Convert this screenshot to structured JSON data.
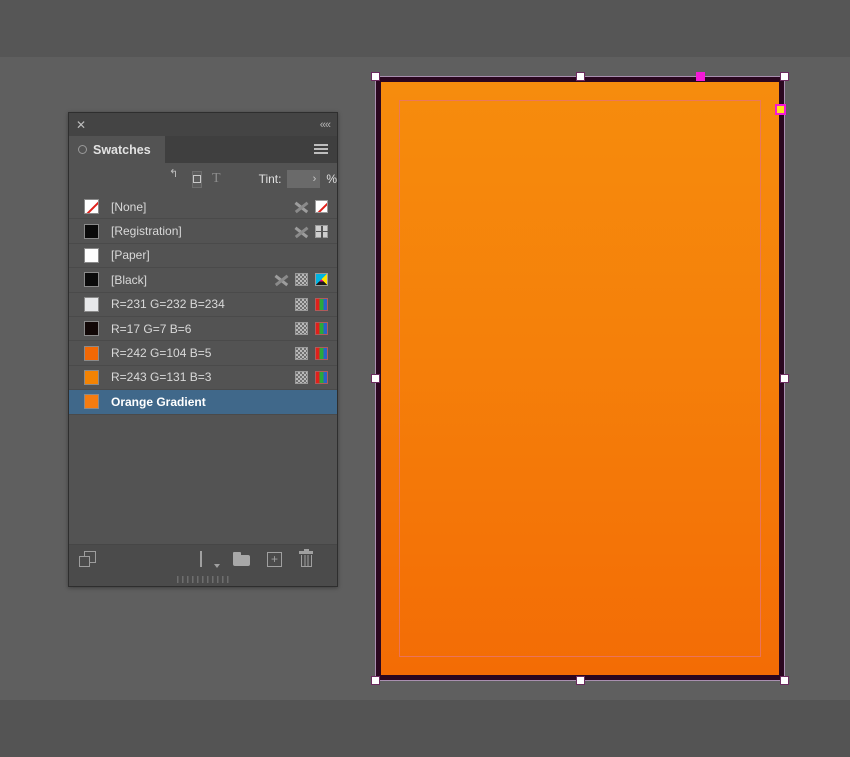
{
  "canvas": {
    "background_top": "#565656",
    "background_mid": "#5f5f5f",
    "background_bottom": "#545454"
  },
  "artwork": {
    "name": "orange-gradient-rectangle",
    "bleed_color": "#2b0720",
    "bleed_outline": "#a98fb0",
    "fill_gradient_start": "#f68c0d",
    "fill_gradient_end": "#f36c05",
    "margin_guide_color": "#e8746a",
    "handle_color": "#ffffff",
    "handle_active_color": "#f518d8",
    "anchor_fill": "#ffe11a",
    "anchor_stroke": "#f518d8"
  },
  "panel": {
    "close_icon": "✕",
    "collapse_icon": "««",
    "tab_label": "Swatches",
    "menu_icon": "hamburger-icon",
    "selected_row_color": "#40688a",
    "background": "#535353"
  },
  "options": {
    "corner_glyph": "↰",
    "fill_stroke_icon": "fill-stroke-icon",
    "text_format_icon": "T",
    "tint_label": "Tint:",
    "tint_value": "",
    "tint_placeholder": "",
    "tint_stepper_icon": "›",
    "tint_unit": "%"
  },
  "swatch_list": {
    "rows": [
      {
        "name": "[None]",
        "chip": "none",
        "chip_color": "#ffffff",
        "lock": true,
        "kind": "none-box",
        "color_space": ""
      },
      {
        "name": "[Registration]",
        "chip": "solid",
        "chip_color": "#0a0a0a",
        "lock": true,
        "kind": "registration",
        "color_space": ""
      },
      {
        "name": "[Paper]",
        "chip": "solid",
        "chip_color": "#ffffff",
        "lock": false,
        "kind": "",
        "color_space": ""
      },
      {
        "name": "[Black]",
        "chip": "solid",
        "chip_color": "#0a0a0a",
        "lock": true,
        "kind": "halftone",
        "color_space": "cmyk"
      },
      {
        "name": "R=231 G=232 B=234",
        "chip": "solid",
        "chip_color": "#e7e8ea",
        "lock": false,
        "kind": "halftone",
        "color_space": "rgb"
      },
      {
        "name": "R=17 G=7 B=6",
        "chip": "solid",
        "chip_color": "#110706",
        "lock": false,
        "kind": "halftone",
        "color_space": "rgb"
      },
      {
        "name": "R=242 G=104 B=5",
        "chip": "solid",
        "chip_color": "#f26805",
        "lock": false,
        "kind": "halftone",
        "color_space": "rgb"
      },
      {
        "name": "R=243 G=131 B=3",
        "chip": "solid",
        "chip_color": "#f38303",
        "lock": false,
        "kind": "halftone",
        "color_space": "rgb"
      },
      {
        "name": "Orange Gradient",
        "chip": "solid",
        "chip_color": "#f57c10",
        "lock": false,
        "kind": "",
        "color_space": "",
        "selected": true
      }
    ]
  },
  "footer": {
    "cc_library_icon": "add-to-cc-library-icon",
    "show_kinds_icon": "show-swatch-kinds-icon",
    "new_group_icon": "new-color-group-icon",
    "new_swatch_icon": "+",
    "delete_icon": "delete-swatch-icon"
  }
}
